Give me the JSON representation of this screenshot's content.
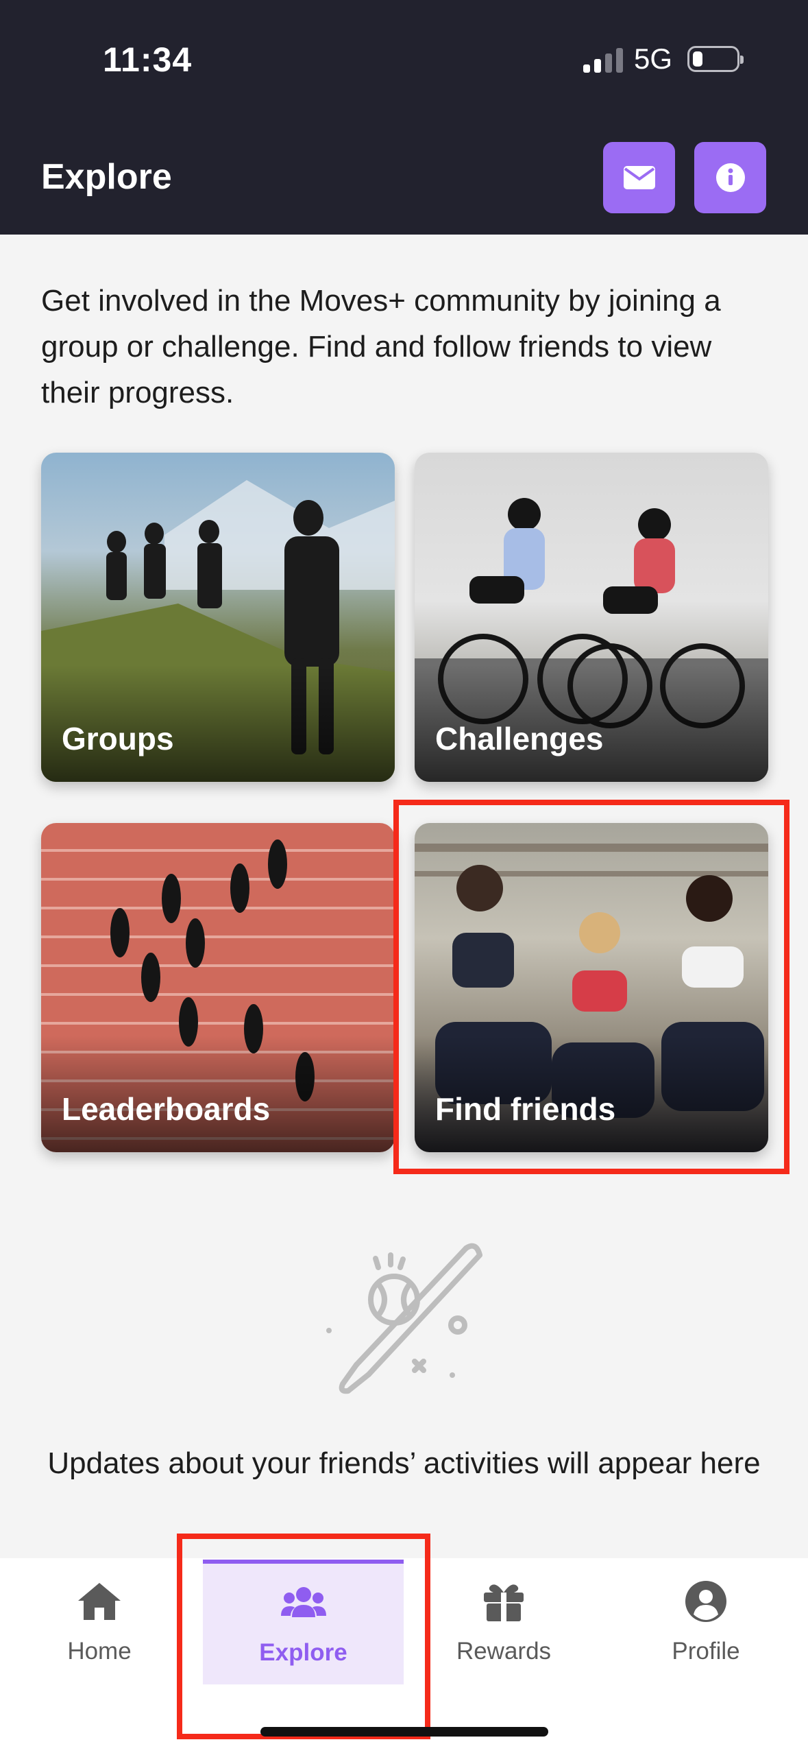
{
  "status": {
    "time": "11:34",
    "network": "5G"
  },
  "header": {
    "title": "Explore",
    "mail_icon": "envelope-icon",
    "info_icon": "info-icon"
  },
  "intro": "Get involved in the Moves+ community by joining a group or challenge. Find and follow friends to view their progress.",
  "cards": [
    {
      "label": "Groups"
    },
    {
      "label": "Challenges"
    },
    {
      "label": "Leaderboards"
    },
    {
      "label": "Find friends"
    }
  ],
  "empty_state": {
    "icon": "baseball-bat-icon",
    "text": "Updates about your friends’ activities will appear here"
  },
  "tabs": [
    {
      "label": "Home",
      "icon": "home-icon"
    },
    {
      "label": "Explore",
      "icon": "users-icon",
      "active": true
    },
    {
      "label": "Rewards",
      "icon": "gift-icon"
    },
    {
      "label": "Profile",
      "icon": "user-circle-icon"
    }
  ],
  "colors": {
    "accent": "#9b6cf3",
    "header_bg": "#22222e",
    "highlight": "#f52a1a"
  }
}
